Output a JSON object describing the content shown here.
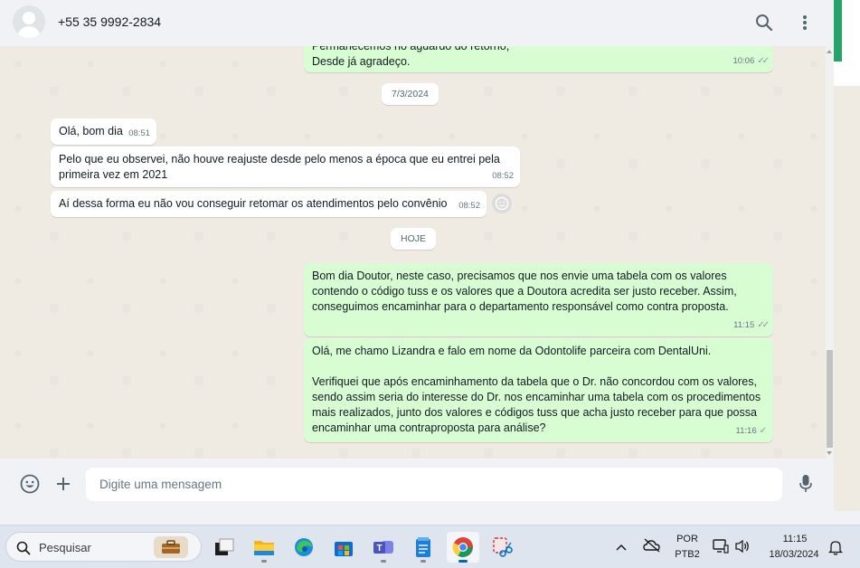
{
  "header": {
    "contact_name": "+55 35 9992-2834",
    "icons": [
      "search-icon",
      "menu-dots-icon"
    ]
  },
  "messages": [
    {
      "dir": "out",
      "text_partial": "Permanecemos no aguardo do retorno,",
      "text": "Desde já agradeço.",
      "time": "10:06",
      "status": "read"
    },
    {
      "type": "date",
      "text": "7/3/2024"
    },
    {
      "dir": "in",
      "text": "Olá, bom dia",
      "time": "08:51"
    },
    {
      "dir": "in",
      "text": "Pelo que eu observei, não houve reajuste desde pelo menos a época que eu entrei pela primeira vez em 2021",
      "time": "08:52"
    },
    {
      "dir": "in",
      "text": "Aí dessa forma eu não vou conseguir retomar os atendimentos pelo convênio",
      "time": "08:52"
    },
    {
      "type": "date",
      "text": "HOJE"
    },
    {
      "dir": "out",
      "text": "Bom dia Doutor, neste caso, precisamos que nos envie uma tabela com os valores contendo o código tuss e os valores que a Doutora acredita ser justo receber. Assim, conseguimos encaminhar para o departamento responsável como contra proposta.",
      "time": "11:15",
      "status": "read"
    },
    {
      "dir": "out",
      "text_p1": "Olá, me chamo Lizandra e falo em nome da Odontolife parceira com DentalUni.",
      "text_p2": "Verifiquei que após encaminhamento da tabela que o Dr. não concordou com os valores, sendo assim seria do interesse do Dr. nos encaminhar uma tabela com os procedimentos mais realizados, junto dos valores e códigos tuss que acha justo receber para que possa encaminhar uma contraproposta para análise?",
      "time": "11:16",
      "status": "sent"
    }
  ],
  "compose": {
    "placeholder": "Digite uma mensagem"
  },
  "taskbar": {
    "search_label": "Pesquisar",
    "language": "POR",
    "keyboard": "PTB2",
    "time": "11:15",
    "date": "18/03/2024"
  },
  "colors": {
    "outgoing_bubble": "#d9fdd3",
    "incoming_bubble": "#ffffff",
    "chat_bg": "#efeae2",
    "accent": "#25a36b"
  }
}
